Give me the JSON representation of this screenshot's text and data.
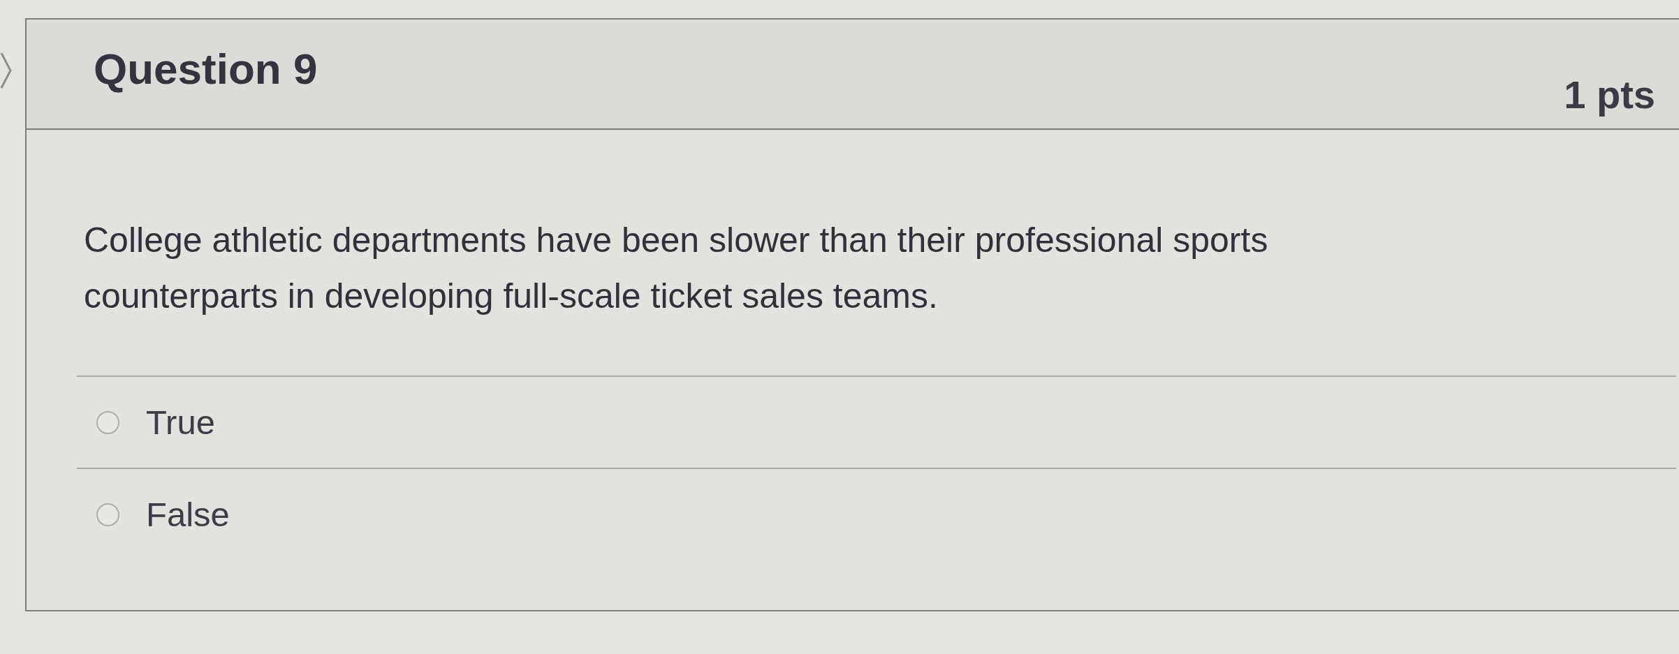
{
  "question": {
    "title": "Question 9",
    "points": "1 pts",
    "text": "College athletic departments have been slower than their professional sports counterparts in developing full-scale ticket sales teams.",
    "answers": [
      {
        "label": "True",
        "selected": false
      },
      {
        "label": "False",
        "selected": false
      }
    ]
  }
}
